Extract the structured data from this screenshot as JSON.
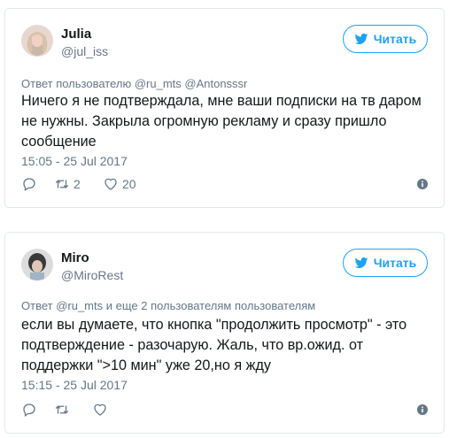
{
  "tweets": [
    {
      "name": "Julia",
      "handle": "@jul_iss",
      "follow_label": "Читать",
      "reply_to": "Ответ пользователю @ru_mts @Antonsssr",
      "text": "Ничего я не подтверждала, мне ваши подписки на тв даром не нужны. Закрыла огромную рекламу и сразу пришло сообщение",
      "time": "15:05 - 25 Jul 2017",
      "retweets": "2",
      "likes": "20"
    },
    {
      "name": "Miro",
      "handle": "@MiroRest",
      "follow_label": "Читать",
      "reply_to": "Ответ @ru_mts и еще 2 пользователям пользователям",
      "text": "если вы думаете, что кнопка \"продолжить просмотр\" - это подтверждение - разочарую. Жаль, что вр.ожид. от поддержки \">10 мин\" уже 20,но я жду",
      "time": "15:15 - 25 Jul 2017",
      "retweets": "",
      "likes": ""
    }
  ],
  "colors": {
    "accent": "#1da1f2",
    "muted": "#657786",
    "border": "#e1e8ed"
  },
  "icons": [
    "twitter-bird-icon",
    "reply-icon",
    "retweet-icon",
    "heart-icon",
    "info-icon"
  ]
}
